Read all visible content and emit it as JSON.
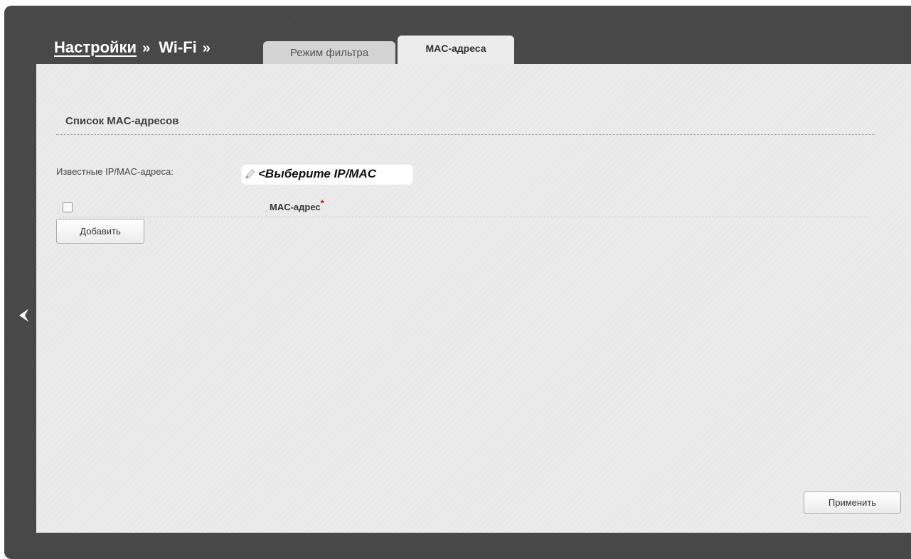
{
  "breadcrumb": {
    "settings": "Настройки",
    "separator1": "»",
    "wifi": "Wi-Fi",
    "separator2": "»"
  },
  "tabs": [
    {
      "label": "Режим фильтра",
      "active": false
    },
    {
      "label": "MAC-адреса",
      "active": true
    }
  ],
  "section": {
    "title": "Список MAC-адресов"
  },
  "known_addresses": {
    "label": "Известные IP/MAC-адреса:",
    "select_value": "<Выберите IP/MAC"
  },
  "table": {
    "columns": [
      "MAC-адрес"
    ],
    "required_mark": "*",
    "rows": []
  },
  "buttons": {
    "add": "Добавить",
    "apply": "Применить"
  },
  "colors": {
    "frame": "#474747",
    "panel": "#ececec",
    "required": "#d01010"
  }
}
